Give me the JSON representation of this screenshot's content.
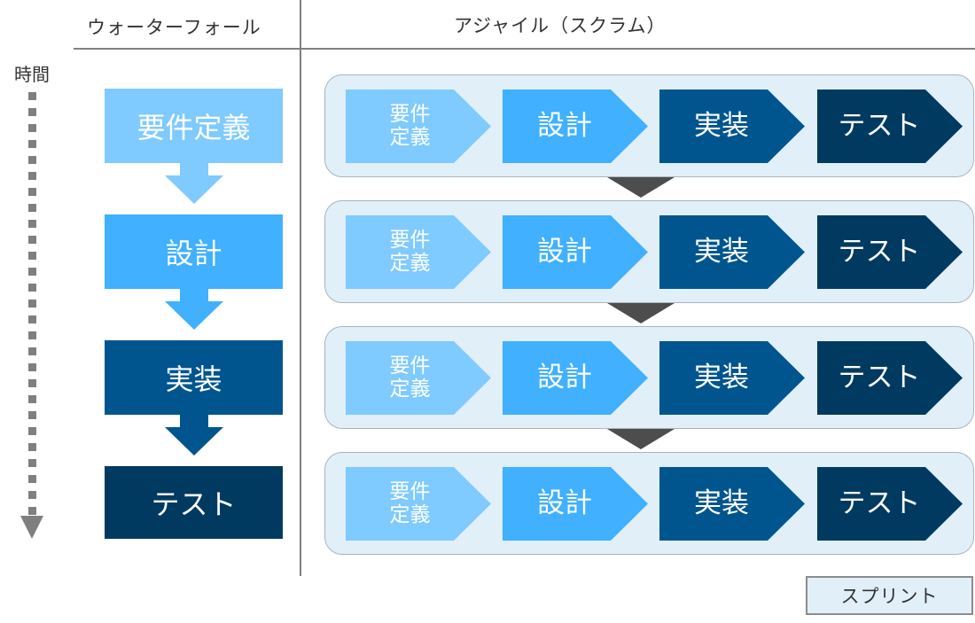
{
  "headers": {
    "waterfall": "ウォーターフォール",
    "agile": "アジャイル（スクラム）"
  },
  "time_axis": {
    "label": "時間",
    "icon": "dotted-down-arrow-icon"
  },
  "waterfall": {
    "steps": [
      {
        "label": "要件定義",
        "color": "#7fcaff"
      },
      {
        "label": "設計",
        "color": "#40b0ff"
      },
      {
        "label": "実装",
        "color": "#00558f"
      },
      {
        "label": "テスト",
        "color": "#003a60"
      }
    ],
    "arrow_colors": [
      "#7fcaff",
      "#40b0ff",
      "#00558f"
    ]
  },
  "agile": {
    "sprints": [
      {
        "steps": [
          "要件\n定義",
          "設計",
          "実装",
          "テスト"
        ]
      },
      {
        "steps": [
          "要件\n定義",
          "設計",
          "実装",
          "テスト"
        ]
      },
      {
        "steps": [
          "要件\n定義",
          "設計",
          "実装",
          "テスト"
        ]
      },
      {
        "steps": [
          "要件\n定義",
          "設計",
          "実装",
          "テスト"
        ]
      }
    ],
    "step_colors": [
      "#7fcaff",
      "#40b0ff",
      "#00558f",
      "#003a60"
    ],
    "sprint_bg": "#e1eff9",
    "connector_color": "#4d4d4d"
  },
  "legend": {
    "sprint_label": "スプリント"
  }
}
